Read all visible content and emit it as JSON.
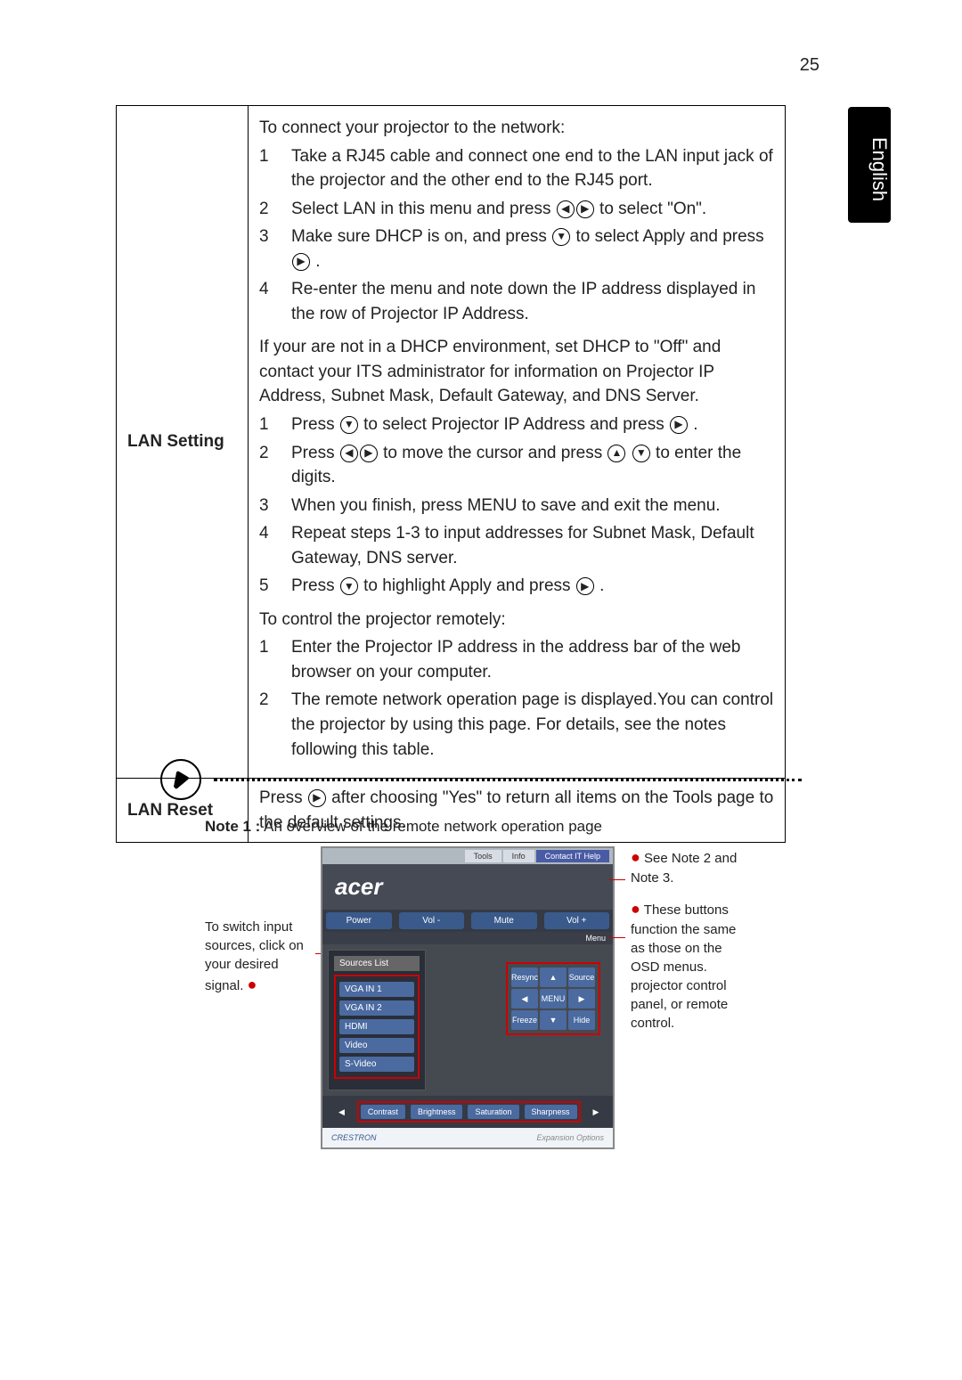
{
  "page_number": "25",
  "language_tab": "English",
  "table": {
    "row1": {
      "label": "LAN Setting",
      "intro": "To connect your projector to the network:",
      "steps_a": [
        "Take a RJ45 cable and connect one end to the LAN input jack of the projector and the other end to the RJ45 port.",
        "Select LAN in this menu and press ◀ ▶ to select \"On\".",
        "Make sure DHCP is on, and press ▼ to select Apply and press ▶ .",
        "Re-enter the menu and note down the IP address displayed in the row of Projector IP Address."
      ],
      "mid_para": "If your are not in a DHCP environment, set DHCP to \"Off\" and contact your ITS administrator for information on Projector IP Address, Subnet Mask, Default Gateway, and DNS Server.",
      "steps_b": [
        "Press ▼ to select Projector IP Address and press ▶ .",
        "Press ◀ ▶ to move the cursor and press ▲ ▼ to enter the digits.",
        "When you finish, press MENU to save and exit the menu.",
        "Repeat steps 1-3 to input addresses for Subnet Mask, Default Gateway, DNS server.",
        "Press ▼ to highlight Apply and press ▶ ."
      ],
      "remote_intro": "To control the projector remotely:",
      "steps_c": [
        "Enter the Projector IP address in the address bar of the web browser on your computer.",
        "The remote network operation page is displayed.You can control the projector by using this page. For details, see the notes following this table."
      ]
    },
    "row2": {
      "label": "LAN Reset",
      "text_a": "Press ",
      "text_b": " after choosing \"Yes\" to return all items on the Tools page to the default settings."
    }
  },
  "note": {
    "title_bold": "Note 1 :",
    "title_rest": " An overview of the remote network operation page",
    "left_caption": "To switch input sources, click on your desired signal.",
    "right_caption_a": "See Note 2 and Note 3.",
    "right_caption_b": "These buttons function the same as those on the OSD menus. projector control panel, or remote control."
  },
  "app": {
    "logo": "acer",
    "tabs": [
      "Tools",
      "Info",
      "Contact IT Help"
    ],
    "toolbar": [
      "Power",
      "Vol -",
      "Mute",
      "Vol +"
    ],
    "menu_label": "Menu",
    "sources_header": "Sources List",
    "sources": [
      "VGA IN 1",
      "VGA IN 2",
      "HDMI",
      "Video",
      "S-Video"
    ],
    "dpad": {
      "up": "▲",
      "down": "▼",
      "left": "◀",
      "right": "▶",
      "tl": "Resync",
      "tr": "Source",
      "ml": "",
      "mc": "MENU",
      "mr": "",
      "bl": "Freeze",
      "br": "Hide"
    },
    "bottom": [
      "Contrast",
      "Brightness",
      "Saturation",
      "Sharpness"
    ],
    "footer_left": "CRESTRON",
    "footer_right": "Expansion Options"
  }
}
